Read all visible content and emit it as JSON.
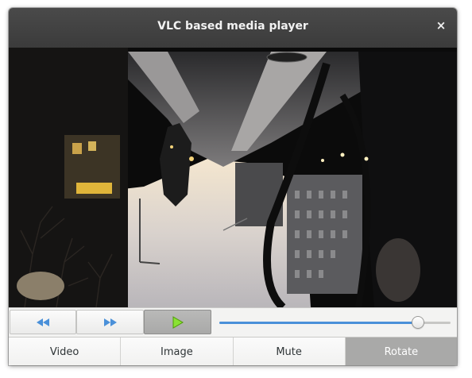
{
  "window": {
    "title": "VLC based media player",
    "close_glyph": "×"
  },
  "video": {
    "description_icon": "video-frame"
  },
  "controls": {
    "rewind_icon": "rewind-icon",
    "fast_forward_icon": "fast-forward-icon",
    "play_icon": "play-icon",
    "seek_position": 0.86,
    "accent_color": "#4a90d9",
    "play_color": "#73d216"
  },
  "tabs": [
    {
      "label": "Video",
      "active": false
    },
    {
      "label": "Image",
      "active": false
    },
    {
      "label": "Mute",
      "active": false
    },
    {
      "label": "Rotate",
      "active": true
    }
  ]
}
